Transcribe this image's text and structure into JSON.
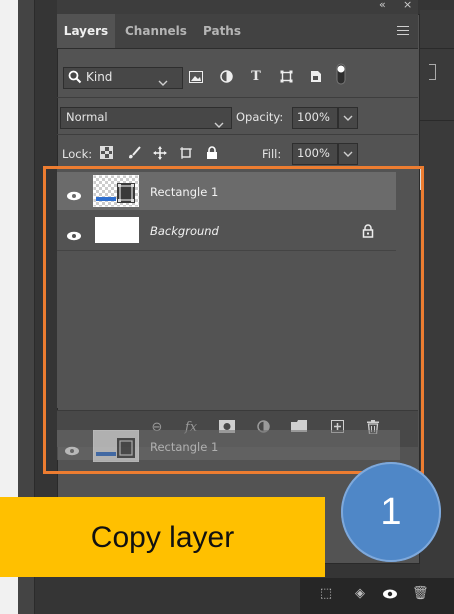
{
  "tabs": [
    {
      "label": "Layers",
      "active": true
    },
    {
      "label": "Channels",
      "active": false
    },
    {
      "label": "Paths",
      "active": false
    }
  ],
  "filter": {
    "kind_label": "Kind",
    "icons": [
      "image-filter-icon",
      "adjustment-filter-icon",
      "type-filter-icon",
      "shape-filter-icon",
      "smart-object-filter-icon",
      "filter-toggle-icon"
    ]
  },
  "blend": {
    "mode": "Normal",
    "opacity_label": "Opacity:",
    "opacity_value": "100%"
  },
  "lock": {
    "label": "Lock:",
    "fill_label": "Fill:",
    "fill_value": "100%"
  },
  "layers": [
    {
      "name": "Rectangle 1",
      "selected": true,
      "visible": true,
      "locked": false
    },
    {
      "name": "Background",
      "selected": false,
      "visible": true,
      "locked": true
    }
  ],
  "drag_ghost": {
    "name": "Rectangle 1"
  },
  "footer_icons": [
    "link-layers-icon",
    "fx-icon",
    "mask-icon",
    "adjustment-layer-icon",
    "group-folder-icon",
    "new-layer-icon",
    "trash-icon"
  ],
  "callout": {
    "label": "Copy layer",
    "step": "1",
    "label_color": "#ffc000",
    "step_color": "#4f87c7",
    "highlight_color": "#ed7d31"
  },
  "fx_text": "fx",
  "type_icon_text": "T"
}
